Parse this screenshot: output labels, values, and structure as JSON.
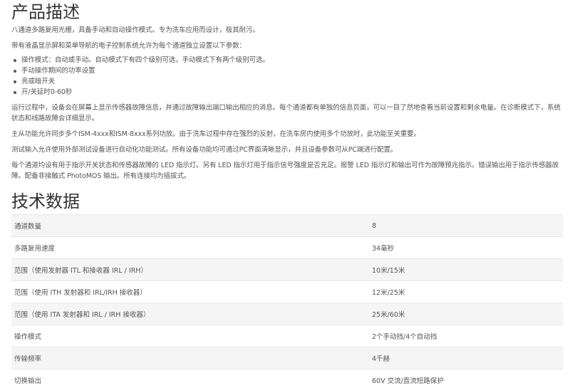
{
  "description": {
    "title": "产品描述",
    "intro": "八通道多路复用光栅，具备手动和自动操作模式。专为洗车应用而设计，极其耐污。",
    "lcd_text": "带有液晶显示屏和菜单导航的电子控制系统允许为每个通道独立设置以下参数：",
    "params": [
      "操作模式：自动或手动。自动模式下有四个级别可选，手动模式下有两个级别可选。",
      "手动操作期间的功率设置",
      "亮或暗开关",
      "开/关延时0-60秒"
    ],
    "runtime": "运行过程中，设备会在屏幕上显示传感器故障信息，并通过故障输出端口输出相应的消息。每个通道都有单独的信息页面，可以一目了然地查看当前设置和剩余电量。在诊断模式下，系统状态和线路故障会详细显示。",
    "master_slave": "主从功能允许同步多个ISM-4xxx和ISM-8xxx系列功放。由于洗车过程中存在强烈的反射，在洗车房内使用多个功放时，此功能至关重要。",
    "test_input": "测试输入允许使用外部测试设备进行自动化功能测试。所有设备功能均可通过PC界面清晰显示，并且设备参数可从PC端进行配置。",
    "leds": "每个通道均设有用于指示开关状态和传感器故障的 LED 指示灯。另有 LED 指示灯用于指示信号强度是否充足。报警 LED 指示灯和输出可作为故障预兆指示。错误输出用于指示传感器故障。配备非接触式 PhotoMOS 输出。所有连接均为插拔式。"
  },
  "specs": {
    "title": "技术数据",
    "rows": [
      {
        "label": "通道数量",
        "value": "8"
      },
      {
        "label": "多路复用速度",
        "value": "34毫秒"
      },
      {
        "label": "范围（使用发射器 ITL 和接收器 IRL / IRH）",
        "value": "10米/15米"
      },
      {
        "label": "范围（使用 ITH 发射器和 IRL/IRH 接收器）",
        "value": "12米/25米"
      },
      {
        "label": "范围（使用 ITA 发射器和 IRL / IRH 接收器）",
        "value": "25米/60米"
      },
      {
        "label": "操作模式",
        "value": "2个手动挡/4个自动挡"
      },
      {
        "label": "传输频率",
        "value": "4千赫"
      },
      {
        "label": "切换输出",
        "value": "60V 交流/直流短路保护"
      }
    ]
  }
}
